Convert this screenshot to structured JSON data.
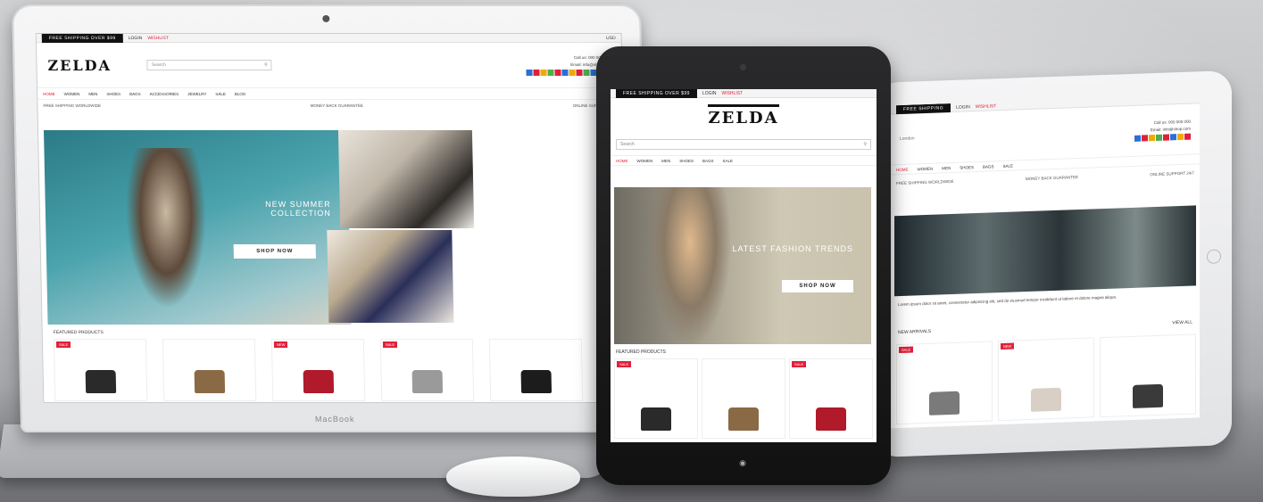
{
  "laptop": {
    "topbar": {
      "black_label": "FREE SHIPPING OVER $99",
      "items": [
        "LOGIN",
        "WISHLIST"
      ],
      "right": "USD"
    },
    "logo": "ZELDA",
    "search_placeholder": "Search",
    "header_right": [
      "Call us: 000 000 000",
      "Email: info@shop.com"
    ],
    "swatch_colors": [
      "#2b6fd6",
      "#e0203a",
      "#f2a900",
      "#4caf50",
      "#e0203a",
      "#2b6fd6",
      "#f2a900",
      "#e0203a",
      "#4caf50",
      "#2b6fd6",
      "#f2a900",
      "#e0203a"
    ],
    "nav": [
      "HOME",
      "WOMEN",
      "MEN",
      "SHOES",
      "BAGS",
      "ACCESSORIES",
      "JEWELRY",
      "SALE",
      "BLOG"
    ],
    "promo": [
      "FREE SHIPPING WORLDWIDE",
      "MONEY BACK GUARANTEE",
      "ONLINE SUPPORT 24/7"
    ],
    "hero": {
      "headline": "NEW SUMMER COLLECTION",
      "button": "SHOP NOW"
    },
    "featured": "FEATURED PRODUCTS",
    "products": [
      {
        "sale": "SALE",
        "color": "#2a2a2a"
      },
      {
        "sale": "",
        "color": "#8a6a44"
      },
      {
        "sale": "NEW",
        "color": "#b01a2a"
      },
      {
        "sale": "SALE",
        "color": "#9a9a9a"
      },
      {
        "sale": "",
        "color": "#1c1c1c"
      }
    ],
    "brand_label": "MacBook"
  },
  "tablet": {
    "topbar": {
      "black_label": "FREE SHIPPING OVER $99",
      "items": [
        "LOGIN",
        "WISHLIST"
      ]
    },
    "logo": "ZELDA",
    "search_placeholder": "Search",
    "nav": [
      "HOME",
      "WOMEN",
      "MEN",
      "SHOES",
      "BAGS",
      "SALE"
    ],
    "hero": {
      "headline": "LATEST FASHION TRENDS",
      "button": "SHOP NOW"
    },
    "featured": "FEATURED PRODUCTS",
    "products": [
      {
        "sale": "SALE",
        "color": "#2a2a2a"
      },
      {
        "sale": "",
        "color": "#8a6a44"
      },
      {
        "sale": "SALE",
        "color": "#b01a2a"
      }
    ]
  },
  "tablet2": {
    "topbar": {
      "black_label": "FREE SHIPPING",
      "items": [
        "LOGIN",
        "WISHLIST"
      ]
    },
    "city": "London",
    "logo": "ZELDA",
    "header_right": [
      "Call us: 000 000 000",
      "Email: info@shop.com"
    ],
    "swatch_colors": [
      "#2b6fd6",
      "#e0203a",
      "#f2a900",
      "#4caf50",
      "#e0203a",
      "#2b6fd6",
      "#f2a900",
      "#e0203a"
    ],
    "nav": [
      "HOME",
      "WOMEN",
      "MEN",
      "SHOES",
      "BAGS",
      "SALE"
    ],
    "promo": [
      "FREE SHIPPING WORLDWIDE",
      "MONEY BACK GUARANTEE",
      "ONLINE SUPPORT 24/7"
    ],
    "caption": "Lorem ipsum dolor sit amet, consectetur adipiscing elit, sed do eiusmod tempor incididunt ut labore et dolore magna aliqua.",
    "featured": "NEW ARRIVALS",
    "view_all": "VIEW ALL",
    "products": [
      {
        "sale": "SALE",
        "color": "#7a7a7a"
      },
      {
        "sale": "NEW",
        "color": "#d8d0c4"
      },
      {
        "sale": "",
        "color": "#3a3a3a"
      }
    ]
  }
}
